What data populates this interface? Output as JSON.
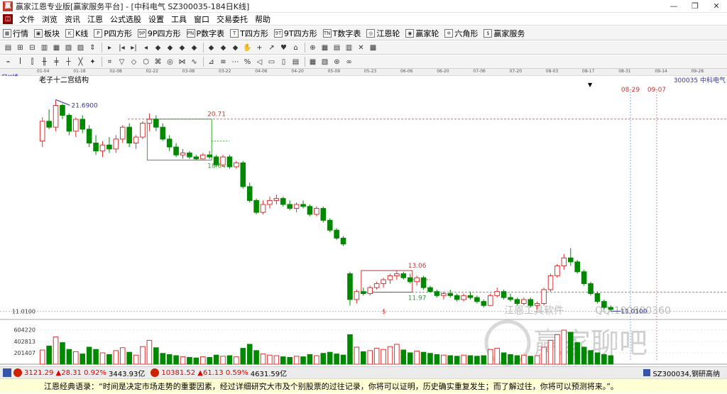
{
  "window": {
    "title": "赢家江恩专业版[赢家服务平台] - [中科电气  SZ300035-184日K线]",
    "app_icon": "赢",
    "controls": [
      "—",
      "❐",
      "✕"
    ]
  },
  "menu": {
    "items": [
      "文件",
      "浏览",
      "资讯",
      "江恩",
      "公式选股",
      "设置",
      "工具",
      "窗口",
      "交易委托",
      "帮助"
    ],
    "mdi_controls": [
      "—",
      "❐",
      "✕"
    ]
  },
  "toolbar1": {
    "items": [
      {
        "icon": "▦",
        "label": "行情"
      },
      {
        "icon": "▣",
        "label": "板块"
      },
      {
        "icon": "K",
        "label": "K线"
      },
      {
        "icon": "P",
        "label": "P四方形"
      },
      {
        "icon": "9P",
        "label": "9P四方形"
      },
      {
        "icon": "PN",
        "label": "P数字表"
      },
      {
        "icon": "T",
        "label": "T四方形"
      },
      {
        "icon": "9T",
        "label": "9T四方形"
      },
      {
        "icon": "TN",
        "label": "T数字表"
      },
      {
        "icon": "◎",
        "label": "江恩轮"
      },
      {
        "icon": "◉",
        "label": "赢家轮"
      },
      {
        "icon": "✡",
        "label": "六角形"
      },
      {
        "icon": "$",
        "label": "赢家服务"
      }
    ]
  },
  "toolbar2": [
    "▤",
    "⊞",
    "⊟",
    "▥",
    "▦",
    "▧",
    "▨",
    "⇕",
    "▸",
    "|◂",
    "▸|",
    "◂",
    "◆",
    "◆",
    "◆",
    "◆",
    "◆",
    "◆",
    "◆",
    "✋",
    "+",
    "↗",
    "♥",
    "⌂",
    "⊕",
    "▦",
    "▤",
    "▥",
    "✕",
    "▩"
  ],
  "toolbar3": [
    "⌁",
    "ꟾ",
    "⫿",
    "╫",
    "╪",
    "┼",
    "╳",
    "✦",
    "⌗",
    "▽",
    "◇",
    "⬡",
    "⌘",
    "◎",
    "⋈",
    "∿",
    "⊿",
    "≡",
    "⋯",
    "%",
    "◁",
    "▭",
    "▯",
    "▤",
    "▦",
    "▧",
    "⊛",
    "∞"
  ],
  "date_axis": [
    "01-04",
    "01-18",
    "02-08",
    "02-22",
    "03-08",
    "03-22",
    "04-06",
    "04-20",
    "05-09",
    "05-23",
    "06-06",
    "06-20",
    "07-06",
    "07-20",
    "08-03",
    "08-17",
    "08-31",
    "09-14",
    "09-28"
  ],
  "period": "日K线",
  "colors": {
    "up": "#e03030",
    "down": "#008800",
    "box_green": "#33aa33",
    "box_red": "#cc3333",
    "future_line_a": "#88aadd",
    "future_line_b": "#dd8888",
    "price_label": "#333399"
  },
  "chart_data": {
    "type": "candlestick",
    "title": "老子十二宫结构",
    "stock_label": "300035 中科电气",
    "future_dates": [
      "08-29",
      "09-07"
    ],
    "annotations": {
      "high": "21.6900",
      "low": "11.0100",
      "box1_top": "20.71",
      "box1_bottom": "18.64",
      "box2_top": "13.06",
      "box2_bottom": "11.97",
      "marker": "$"
    },
    "y_axis_price_label": "11.0100",
    "volume_axis_labels": [
      "604220",
      "402813",
      "201407"
    ],
    "ohlc": [
      [
        19.6,
        20.8,
        19.3,
        20.6
      ],
      [
        20.6,
        21.2,
        20.2,
        20.3
      ],
      [
        20.3,
        21.69,
        20.1,
        21.4
      ],
      [
        21.4,
        21.5,
        20.7,
        20.9
      ],
      [
        20.9,
        21.0,
        19.9,
        20.1
      ],
      [
        20.1,
        20.8,
        19.8,
        20.7
      ],
      [
        20.7,
        20.9,
        20.0,
        20.2
      ],
      [
        20.2,
        20.4,
        19.3,
        19.5
      ],
      [
        19.5,
        19.9,
        18.9,
        19.1
      ],
      [
        19.1,
        19.6,
        18.8,
        19.4
      ],
      [
        19.4,
        19.8,
        19.0,
        19.2
      ],
      [
        19.2,
        19.9,
        19.0,
        19.7
      ],
      [
        19.7,
        20.4,
        19.5,
        20.3
      ],
      [
        20.3,
        20.5,
        19.3,
        19.5
      ],
      [
        19.5,
        19.9,
        19.2,
        19.8
      ],
      [
        19.8,
        20.6,
        19.7,
        20.5
      ],
      [
        20.5,
        21.0,
        20.1,
        20.7
      ],
      [
        20.7,
        20.9,
        20.1,
        20.3
      ],
      [
        20.3,
        20.5,
        19.6,
        19.7
      ],
      [
        19.7,
        19.9,
        19.1,
        19.3
      ],
      [
        19.3,
        19.5,
        18.8,
        18.9
      ],
      [
        18.9,
        19.2,
        18.7,
        19.0
      ],
      [
        19.0,
        19.1,
        18.7,
        18.8
      ],
      [
        18.8,
        18.9,
        18.64,
        18.7
      ],
      [
        18.7,
        19.0,
        18.7,
        18.9
      ],
      [
        18.9,
        19.1,
        18.7,
        18.8
      ],
      [
        18.8,
        18.9,
        18.3,
        18.4
      ],
      [
        18.4,
        18.9,
        18.3,
        18.8
      ],
      [
        18.8,
        18.9,
        18.2,
        18.3
      ],
      [
        18.3,
        18.6,
        18.2,
        18.5
      ],
      [
        18.5,
        18.6,
        17.2,
        17.3
      ],
      [
        17.3,
        17.5,
        16.5,
        16.6
      ],
      [
        16.6,
        16.7,
        15.9,
        16.0
      ],
      [
        16.0,
        16.6,
        15.9,
        16.4
      ],
      [
        16.4,
        16.8,
        16.2,
        16.6
      ],
      [
        16.6,
        16.9,
        16.4,
        16.7
      ],
      [
        16.7,
        16.8,
        16.3,
        16.4
      ],
      [
        16.4,
        16.6,
        16.1,
        16.2
      ],
      [
        16.2,
        16.5,
        16.0,
        16.4
      ],
      [
        16.4,
        16.6,
        16.2,
        16.3
      ],
      [
        16.3,
        16.4,
        15.8,
        15.9
      ],
      [
        15.9,
        16.3,
        15.8,
        16.2
      ],
      [
        16.2,
        16.3,
        15.5,
        15.6
      ],
      [
        15.6,
        15.7,
        15.0,
        15.1
      ],
      [
        15.1,
        15.2,
        14.6,
        14.7
      ],
      [
        14.7,
        14.8,
        14.3,
        14.4
      ],
      [
        12.9,
        13.0,
        11.3,
        11.6
      ],
      [
        11.6,
        12.1,
        11.4,
        12.0
      ],
      [
        12.0,
        12.2,
        11.8,
        11.9
      ],
      [
        11.9,
        12.3,
        11.8,
        12.2
      ],
      [
        12.2,
        12.5,
        12.1,
        12.4
      ],
      [
        12.4,
        12.7,
        12.2,
        12.6
      ],
      [
        12.6,
        12.9,
        12.4,
        12.8
      ],
      [
        12.8,
        13.06,
        12.6,
        12.9
      ],
      [
        12.9,
        13.0,
        12.6,
        12.7
      ],
      [
        12.7,
        12.9,
        12.4,
        12.5
      ],
      [
        12.5,
        12.8,
        12.3,
        12.7
      ],
      [
        12.7,
        12.8,
        12.1,
        12.2
      ],
      [
        12.2,
        12.3,
        11.97,
        12.0
      ],
      [
        12.0,
        12.1,
        11.7,
        11.8
      ],
      [
        11.8,
        12.0,
        11.6,
        11.9
      ],
      [
        11.9,
        12.1,
        11.7,
        11.8
      ],
      [
        11.8,
        11.9,
        11.5,
        11.6
      ],
      [
        11.6,
        11.9,
        11.5,
        11.8
      ],
      [
        11.8,
        12.0,
        11.6,
        11.7
      ],
      [
        11.7,
        11.8,
        11.4,
        11.5
      ],
      [
        11.5,
        11.6,
        11.2,
        11.3
      ],
      [
        11.3,
        11.9,
        11.3,
        11.8
      ],
      [
        11.8,
        12.2,
        11.7,
        12.0
      ],
      [
        12.0,
        12.1,
        11.6,
        11.7
      ],
      [
        11.7,
        11.9,
        11.5,
        11.6
      ],
      [
        11.6,
        11.7,
        11.3,
        11.4
      ],
      [
        11.4,
        11.7,
        11.3,
        11.6
      ],
      [
        11.6,
        11.7,
        11.2,
        11.3
      ],
      [
        11.3,
        11.5,
        11.1,
        11.4
      ],
      [
        11.4,
        12.2,
        11.3,
        12.1
      ],
      [
        12.1,
        12.9,
        12.0,
        12.8
      ],
      [
        12.8,
        13.4,
        12.7,
        13.3
      ],
      [
        13.3,
        13.9,
        13.1,
        13.7
      ],
      [
        13.7,
        14.2,
        13.3,
        13.5
      ],
      [
        13.5,
        13.6,
        12.9,
        13.0
      ],
      [
        13.0,
        13.1,
        12.3,
        12.4
      ],
      [
        12.4,
        12.5,
        11.8,
        11.9
      ],
      [
        11.9,
        12.0,
        11.4,
        11.5
      ],
      [
        11.5,
        11.6,
        11.1,
        11.2
      ],
      [
        11.2,
        11.3,
        11.01,
        11.1
      ]
    ],
    "volume": [
      250000,
      320000,
      480000,
      380000,
      260000,
      220000,
      180000,
      300000,
      260000,
      200000,
      170000,
      240000,
      290000,
      210000,
      160000,
      310000,
      420000,
      290000,
      190000,
      170000,
      150000,
      130000,
      120000,
      110000,
      130000,
      120000,
      160000,
      140000,
      150000,
      130000,
      280000,
      350000,
      240000,
      180000,
      160000,
      150000,
      130000,
      120000,
      140000,
      130000,
      170000,
      150000,
      190000,
      210000,
      180000,
      160000,
      520000,
      300000,
      220000,
      240000,
      280000,
      260000,
      310000,
      350000,
      250000,
      200000,
      230000,
      210000,
      190000,
      170000,
      160000,
      150000,
      140000,
      160000,
      150000,
      140000,
      150000,
      260000,
      280000,
      200000,
      170000,
      150000,
      160000,
      140000,
      150000,
      300000,
      420000,
      520000,
      600000,
      560000,
      380000,
      300000,
      240000,
      200000,
      170000,
      150000
    ]
  },
  "status": {
    "sh_value": "3121.29",
    "sh_change": "▲28.31",
    "sh_pct": "0.92%",
    "sh_amount": "3443.93亿",
    "sz_value": "10381.52",
    "sz_change": "▲61.13",
    "sz_pct": "0.59%",
    "sz_amount": "4631.59亿",
    "right_text": "SZ300034,钢研高纳"
  },
  "watermarks": {
    "software": "江恩工具软件",
    "qq": "QQ:100800360",
    "brand": "赢家聊吧",
    "url": "jiaoba.yjcs"
  },
  "quote": "江恩经典语录：“时间是决定市场走势的重要因素，经过详细研究大市及个别股票的过往记录，你将可以证明，历史确实重复发生；而了解过往，你将可以预测将来。”。"
}
